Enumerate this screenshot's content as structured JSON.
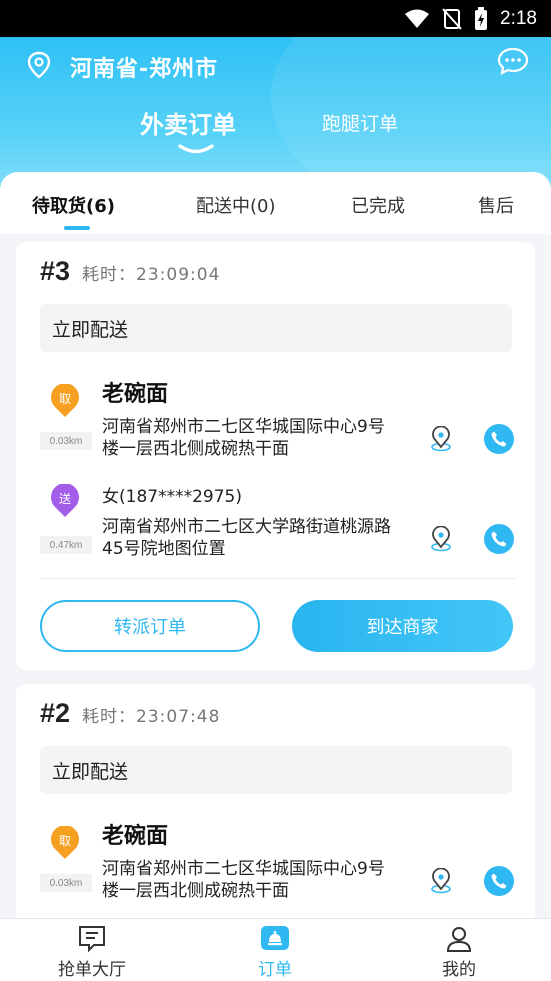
{
  "status_bar": {
    "time": "2:18"
  },
  "header": {
    "location": "河南省-郑州市",
    "tabs": [
      {
        "label": "外卖订单",
        "active": true
      },
      {
        "label": "跑腿订单",
        "active": false
      }
    ]
  },
  "sub_tabs": [
    {
      "label": "待取货(6)",
      "active": true
    },
    {
      "label": "配送中(0)",
      "active": false
    },
    {
      "label": "已完成",
      "active": false
    },
    {
      "label": "售后",
      "active": false
    }
  ],
  "orders": [
    {
      "number": "#3",
      "elapsed": "耗时：23:09:04",
      "delivery_type": "立即配送",
      "pickup": {
        "badge": "取",
        "distance": "0.03km",
        "name": "老碗面",
        "address": "河南省郑州市二七区华城国际中心9号楼一层西北侧成碗热干面"
      },
      "dropoff": {
        "badge": "送",
        "distance": "0.47km",
        "contact": "女(187****2975)",
        "address": "河南省郑州市二七区大学路街道桃源路45号院地图位置"
      },
      "actions": {
        "reassign": "转派订单",
        "arrive": "到达商家"
      }
    },
    {
      "number": "#2",
      "elapsed": "耗时：23:07:48",
      "delivery_type": "立即配送",
      "pickup": {
        "badge": "取",
        "distance": "0.03km",
        "name": "老碗面",
        "address": "河南省郑州市二七区华城国际中心9号楼一层西北侧成碗热干面"
      }
    }
  ],
  "bottom_nav": [
    {
      "label": "抢单大厅",
      "icon": "hall-icon",
      "active": false
    },
    {
      "label": "订单",
      "icon": "order-icon",
      "active": true
    },
    {
      "label": "我的",
      "icon": "profile-icon",
      "active": false
    }
  ],
  "colors": {
    "accent": "#2fb8f2",
    "pickup": "#f5a021",
    "dropoff": "#a45de8"
  }
}
